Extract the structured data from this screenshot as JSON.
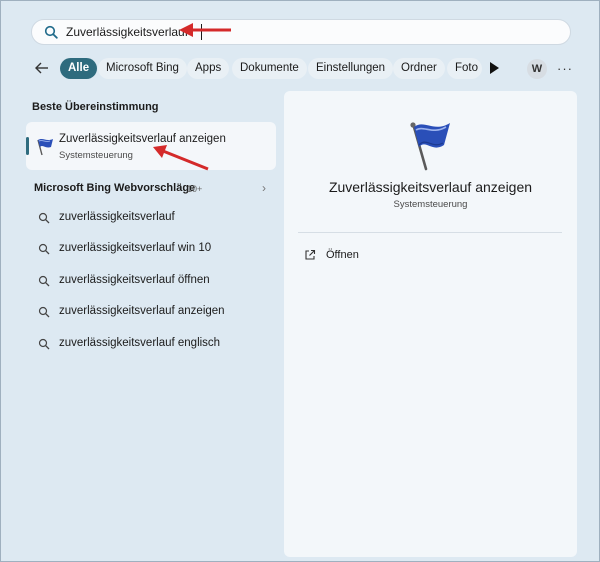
{
  "search": {
    "query": "Zuverlässigkeitsverlauf",
    "icon": "search-icon"
  },
  "filters": {
    "back_icon": "arrow-left-icon",
    "chips": [
      "Alle",
      "Microsoft Bing",
      "Apps",
      "Dokumente",
      "Einstellungen",
      "Ordner",
      "Foto"
    ],
    "active_index": 0,
    "more_icon": "play-icon",
    "avatar_letter": "W",
    "overflow_label": "···"
  },
  "best_match": {
    "section_title": "Beste Übereinstimmung",
    "name": "Zuverlässigkeitsverlauf anzeigen",
    "category": "Systemsteuerung",
    "icon": "blue-flag-icon"
  },
  "bing": {
    "section_title": "Microsoft Bing Webvorschläge",
    "count": "10+",
    "chevron": "›",
    "suggestions": [
      "zuverlässigkeitsverlauf",
      "zuverlässigkeitsverlauf win 10",
      "zuverlässigkeitsverlauf öffnen",
      "zuverlässigkeitsverlauf anzeigen",
      "zuverlässigkeitsverlauf englisch"
    ]
  },
  "detail": {
    "title": "Zuverlässigkeitsverlauf anzeigen",
    "category": "Systemsteuerung",
    "actions": [
      {
        "label": "Öffnen",
        "icon": "open-external-icon"
      }
    ]
  },
  "colors": {
    "accent": "#2e6b7e",
    "annotation_arrow": "#d42a2a",
    "background": "#dde9f2"
  }
}
